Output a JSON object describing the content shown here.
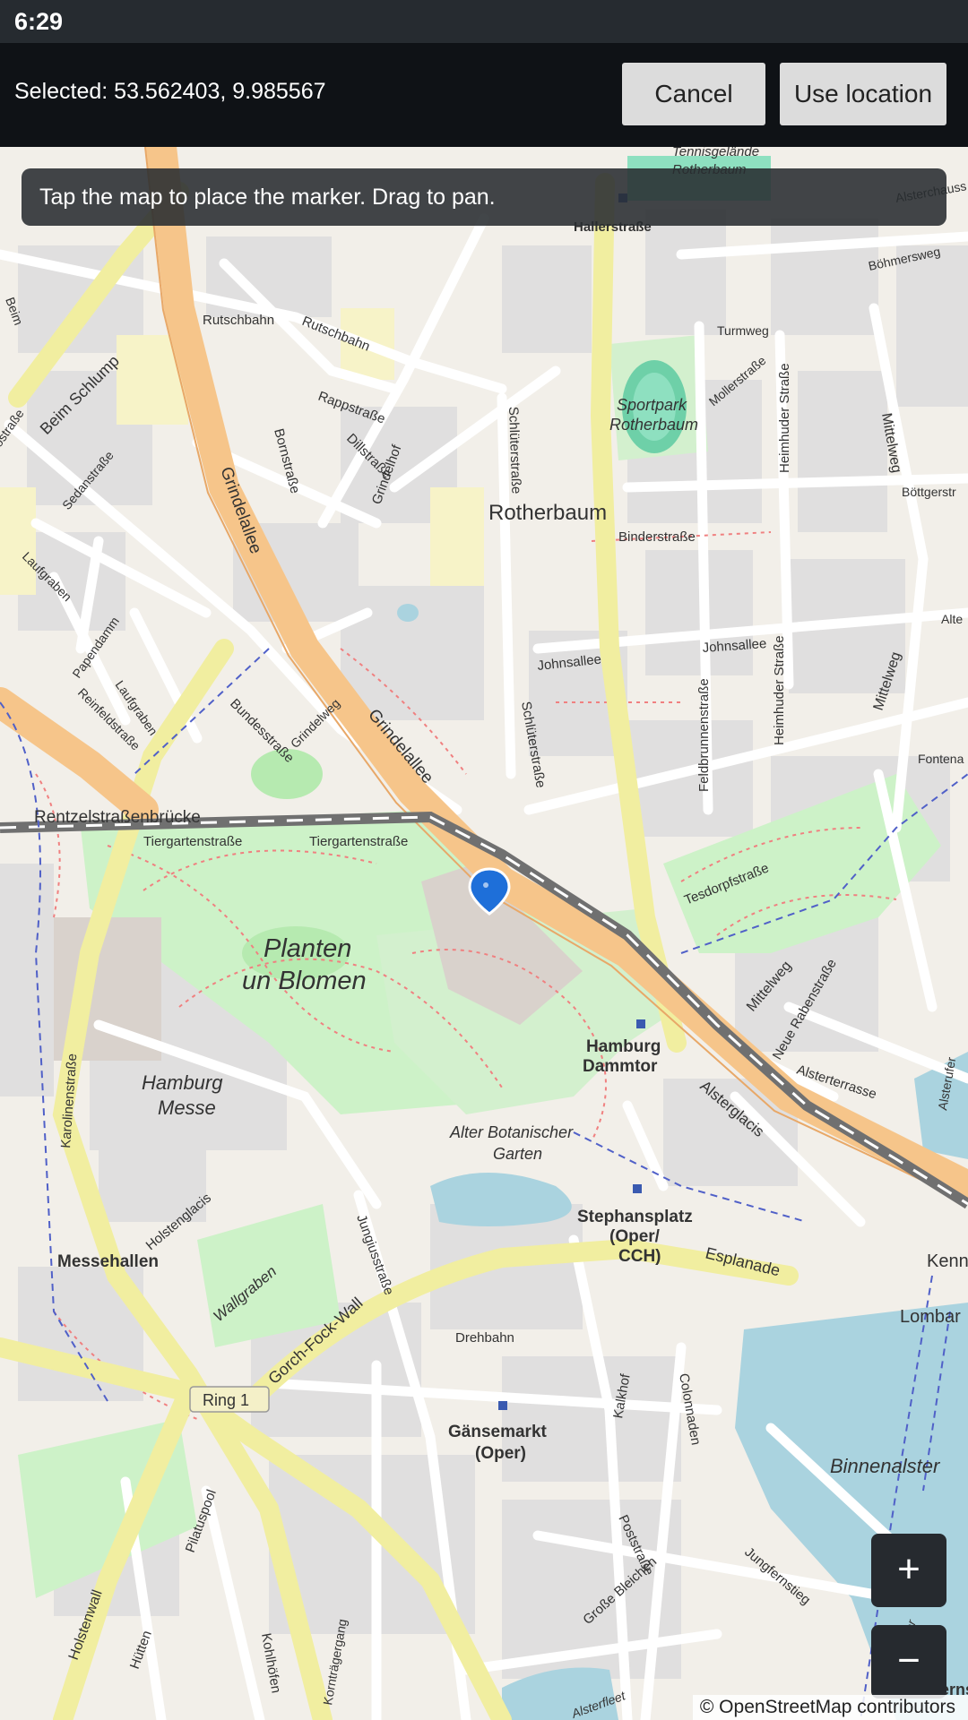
{
  "status_bar": {
    "time": "6:29"
  },
  "top_bar": {
    "selected_text": "Selected: 53.562403, 9.985567",
    "cancel_label": "Cancel",
    "use_location_label": "Use location"
  },
  "map": {
    "hint": "Tap the map to place the marker. Drag to pan.",
    "zoom_in_label": "+",
    "zoom_out_label": "−",
    "attribution": "© OpenStreetMap contributors",
    "labels": {
      "rotherbaum": "Rotherbaum",
      "planten": "Planten",
      "un_blomen": "un Blomen",
      "hamburg": "Hamburg",
      "messe": "Messe",
      "sportpark": "Sportpark",
      "rotherbaum2": "Rotherbaum",
      "alter_botanischer": "Alter Botanischer",
      "garten": "Garten",
      "messehallen": "Messehallen",
      "hamburg_station": "Hamburg",
      "dammtor": "Dammtor",
      "stephansplatz": "Stephansplatz",
      "oper_cch": "(Oper/",
      "cch": "CCH)",
      "gaensemarkt": "Gänsemarkt",
      "oper": "(Oper)",
      "binnenalster": "Binnenalster",
      "ring1": "Ring 1",
      "grindelallee": "Grindelallee",
      "grindelallee2": "Grindelallee",
      "rentzelstrasse": "Rentzelstraßenbrücke",
      "tiergartenstrasse": "Tiergartenstraße",
      "tiergartenstrasse2": "Tiergartenstraße",
      "beim_schlump": "Beim Schlump",
      "rutschbahn": "Rutschbahn",
      "rutschbahn2": "Rutschbahn",
      "rappstrasse": "Rappstraße",
      "bornstrasse": "Bornstraße",
      "dillstrasse": "Dillstraße",
      "grindelhof": "Grindelhof",
      "schlueterstrasse": "Schlüterstraße",
      "schlueterstrasse2": "Schlüterstraße",
      "binderstrasse": "Binderstraße",
      "johnsallee": "Johnsallee",
      "johnsallee2": "Johnsallee",
      "feldbrunnenstrasse": "Feldbrunnenstraße",
      "heimhuder": "Heimhuder Straße",
      "heimhuder2": "Heimhuder Straße",
      "mittelweg": "Mittelweg",
      "mittelweg2": "Mittelweg",
      "mittelweg3": "Mittelweg",
      "tesdorpfstrasse": "Tesdorpfstraße",
      "neue_rabenstrasse": "Neue Rabenstraße",
      "alsterterrasse": "Alsterterrasse",
      "alsterglacis": "Alsterglacis",
      "esplanade": "Esplanade",
      "gorch_fock_wall": "Gorch-Fock-Wall",
      "jungiusstrasse": "Jungiusstraße",
      "karolinenstrasse": "Karolinenstraße",
      "holstenglacis": "Holstenglacis",
      "wallgraben": "Wallgraben",
      "drehbahn": "Drehbahn",
      "kalkhof": "Kalkhof",
      "colonnaden": "Colonnaden",
      "poststrasse": "Poststraße",
      "jungfernstieg": "Jungfernstieg",
      "grosse_bleichen": "Große Bleichen",
      "holstenwall": "Holstenwall",
      "pilatuspool": "Pilatuspool",
      "kohlhoefen": "Kohlhöfen",
      "huetten": "Hütten",
      "kornträgergang": "Kornträgergang",
      "bundesstrasse": "Bundesstraße",
      "grindelweg": "Grindelweg",
      "laufgraben": "Laufgraben",
      "laufgraben2": "Laufgraben",
      "papendamm": "Papendamm",
      "reinfeldstrasse": "Reinfeldstraße",
      "sedanstrasse": "Sedanstraße",
      "hallerstrasse": "Hallerstraße",
      "turmweg": "Turmweg",
      "mollerstrasse": "Mollerstraße",
      "boehmersweg": "Böhmersweg",
      "boettgerstrasse": "Böttgerstr",
      "fontenay": "Fontena",
      "kennedy": "Kenn",
      "lombard": "Lombar",
      "jungfernstieg_station": "Jungfernst",
      "alsterchaussee": "Alsterchauss",
      "alsterufer": "Alsterufer",
      "tennisgelaende": "Tennisgelände",
      "tennis_rotherbaum": "Rotherbaum",
      "alster_label": "Alster",
      "alsterfleet": "Alsterfleet",
      "ufer": "Alte",
      "beim_strasse": "Beim",
      "ostrasse": "ostraße"
    }
  }
}
